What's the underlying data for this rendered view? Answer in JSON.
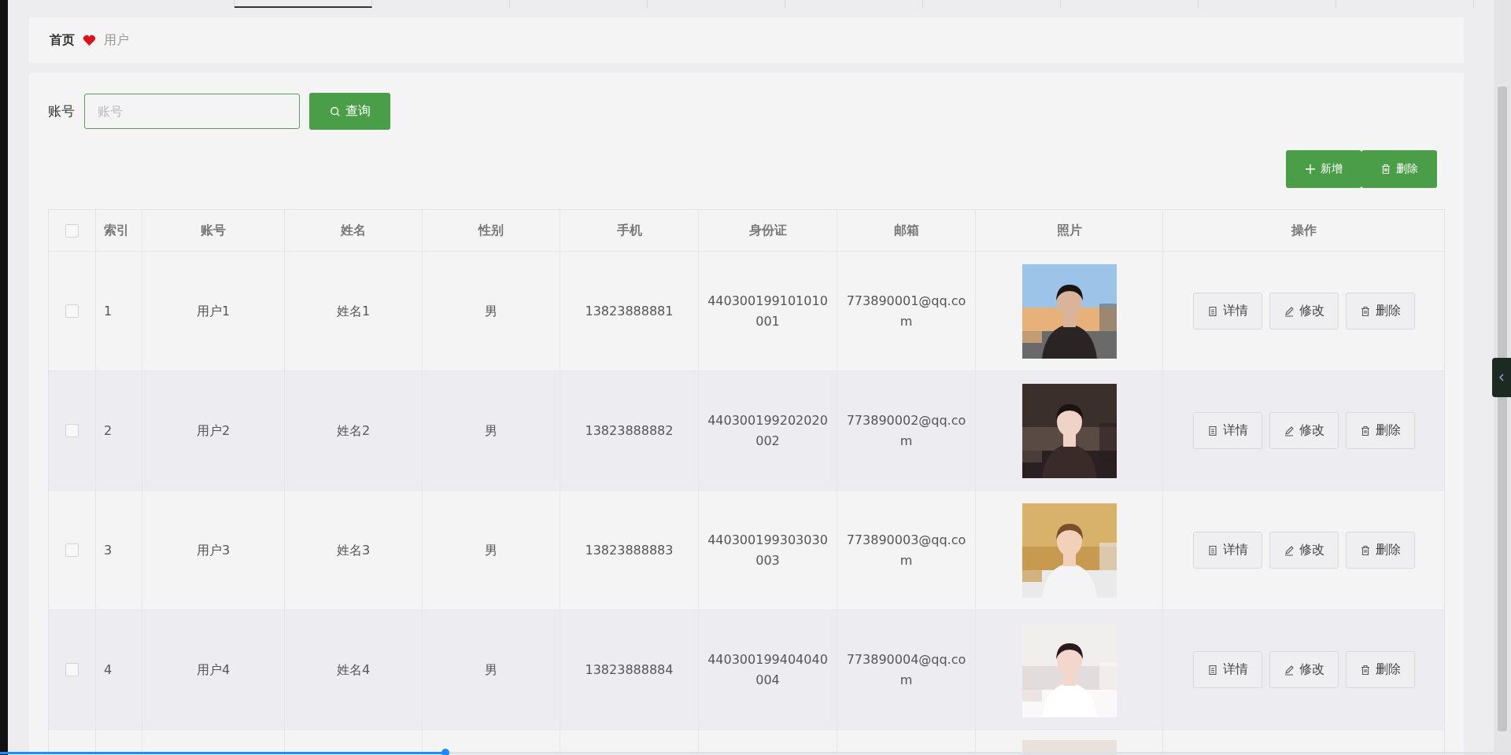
{
  "tabs": [
    {
      "selected": false
    },
    {
      "selected": true
    },
    {
      "selected": false
    },
    {
      "selected": false
    },
    {
      "selected": false
    },
    {
      "selected": false
    },
    {
      "selected": false
    },
    {
      "selected": false
    },
    {
      "selected": false
    },
    {
      "selected": false
    }
  ],
  "progress": {
    "level": 0.295
  },
  "breadcrumb": {
    "home": "首页",
    "current": "用户"
  },
  "search": {
    "label": "账号",
    "placeholder": "账号",
    "button": "查询"
  },
  "toolbar": [
    {
      "kind": "add",
      "label": "新增"
    },
    {
      "kind": "delete",
      "label": "删除"
    }
  ],
  "table": {
    "select_all_checked": false,
    "columns": [
      "索引",
      "账号",
      "姓名",
      "性别",
      "手机",
      "身份证",
      "邮箱",
      "照片",
      "操作"
    ],
    "rows": [
      {
        "checked": false,
        "cells": [
          "1",
          "用户1",
          "姓名1",
          "男",
          "13823888881",
          "440300199101010001",
          "773890001@qq.com"
        ],
        "photo": {
          "kind": "picture"
        },
        "actions": [
          {
            "kind": "detail",
            "label": "详情"
          },
          {
            "kind": "edit",
            "label": "修改"
          },
          {
            "kind": "delete",
            "label": "删除"
          }
        ]
      },
      {
        "checked": false,
        "cells": [
          "2",
          "用户2",
          "姓名2",
          "男",
          "13823888882",
          "440300199202020002",
          "773890002@qq.com"
        ],
        "photo": {
          "kind": "picture"
        },
        "actions": [
          {
            "kind": "detail",
            "label": "详情"
          },
          {
            "kind": "edit",
            "label": "修改"
          },
          {
            "kind": "delete",
            "label": "删除"
          }
        ]
      },
      {
        "checked": false,
        "cells": [
          "3",
          "用户3",
          "姓名3",
          "男",
          "13823888883",
          "440300199303030003",
          "773890003@qq.com"
        ],
        "photo": {
          "kind": "picture"
        },
        "actions": [
          {
            "kind": "detail",
            "label": "详情"
          },
          {
            "kind": "edit",
            "label": "修改"
          },
          {
            "kind": "delete",
            "label": "删除"
          }
        ]
      },
      {
        "checked": false,
        "cells": [
          "4",
          "用户4",
          "姓名4",
          "男",
          "13823888884",
          "440300199404040004",
          "773890004@qq.com"
        ],
        "photo": {
          "kind": "picture"
        },
        "actions": [
          {
            "kind": "detail",
            "label": "详情"
          },
          {
            "kind": "edit",
            "label": "修改"
          },
          {
            "kind": "delete",
            "label": "删除"
          }
        ]
      }
    ]
  }
}
